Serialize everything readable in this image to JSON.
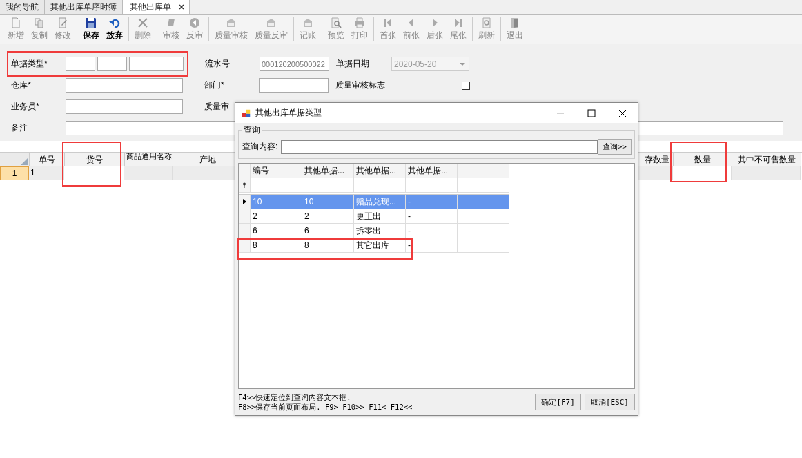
{
  "tabs": [
    {
      "label": "我的导航",
      "selected": false,
      "closable": false
    },
    {
      "label": "其他出库单序时簿",
      "selected": false,
      "closable": false
    },
    {
      "label": "其他出库单",
      "selected": true,
      "closable": true
    }
  ],
  "toolbar": {
    "groups": [
      [
        {
          "label": "新增",
          "kind": "new",
          "enabled": false
        },
        {
          "label": "复制",
          "kind": "copy",
          "enabled": false
        },
        {
          "label": "修改",
          "kind": "edit",
          "enabled": false
        }
      ],
      [
        {
          "label": "保存",
          "kind": "save",
          "enabled": true
        },
        {
          "label": "放弃",
          "kind": "undo",
          "enabled": true
        }
      ],
      [
        {
          "label": "删除",
          "kind": "delete",
          "enabled": false
        }
      ],
      [
        {
          "label": "审核",
          "kind": "stamp",
          "enabled": false
        },
        {
          "label": "反审",
          "kind": "back",
          "enabled": false
        }
      ],
      [
        {
          "label": "质量审核",
          "kind": "folder",
          "enabled": false
        },
        {
          "label": "质量反审",
          "kind": "folder",
          "enabled": false
        }
      ],
      [
        {
          "label": "记账",
          "kind": "folder",
          "enabled": false
        }
      ],
      [
        {
          "label": "预览",
          "kind": "preview",
          "enabled": false
        },
        {
          "label": "打印",
          "kind": "print",
          "enabled": false
        }
      ],
      [
        {
          "label": "首张",
          "kind": "first",
          "enabled": false
        },
        {
          "label": "前张",
          "kind": "prev",
          "enabled": false
        },
        {
          "label": "后张",
          "kind": "next",
          "enabled": false
        },
        {
          "label": "尾张",
          "kind": "last",
          "enabled": false
        }
      ],
      [
        {
          "label": "刷新",
          "kind": "refresh",
          "enabled": false
        }
      ],
      [
        {
          "label": "退出",
          "kind": "exit",
          "enabled": false
        }
      ]
    ]
  },
  "form": {
    "bill_type": {
      "label": "单据类型*"
    },
    "serial": {
      "label": "流水号",
      "value": "000120200500022"
    },
    "bill_date": {
      "label": "单据日期",
      "value": "2020-05-20"
    },
    "warehouse": {
      "label": "仓库*"
    },
    "department": {
      "label": "部门*"
    },
    "quality_flag": {
      "label": "质量审核标志",
      "checked": false
    },
    "clerk": {
      "label": "业务员*"
    },
    "quality_auditor": {
      "label": "质量审"
    },
    "remark": {
      "label": "备注"
    }
  },
  "grid": {
    "columns": [
      "单号",
      "货号",
      "商品通用名称",
      "产地",
      "存数量",
      "数量",
      "其中不可售数量"
    ],
    "rows": [
      {
        "header": "1",
        "cells": [
          "1",
          "",
          "",
          "",
          "",
          "",
          ""
        ]
      }
    ]
  },
  "dialog": {
    "title": "其他出库单据类型",
    "group_label": "查询",
    "query_label": "查询内容:",
    "query_button": "查询>>",
    "columns": [
      "编号",
      "其他单据...",
      "其他单据...",
      "其他单据..."
    ],
    "rows": [
      {
        "cells": [
          "10",
          "10",
          "赠品兑现...",
          "-"
        ],
        "selected": true
      },
      {
        "cells": [
          "2",
          "2",
          "更正出",
          "-"
        ],
        "selected": false
      },
      {
        "cells": [
          "6",
          "6",
          "拆零出",
          "-"
        ],
        "selected": false
      },
      {
        "cells": [
          "8",
          "8",
          "其它出库",
          "-"
        ],
        "selected": false
      }
    ],
    "hints": [
      "F4>>快速定位到查询内容文本框.",
      "F8>>保存当前页面布局. F9> F10>> F11< F12<<"
    ],
    "buttons": [
      "确定[F7]",
      "取消[ESC]"
    ]
  }
}
